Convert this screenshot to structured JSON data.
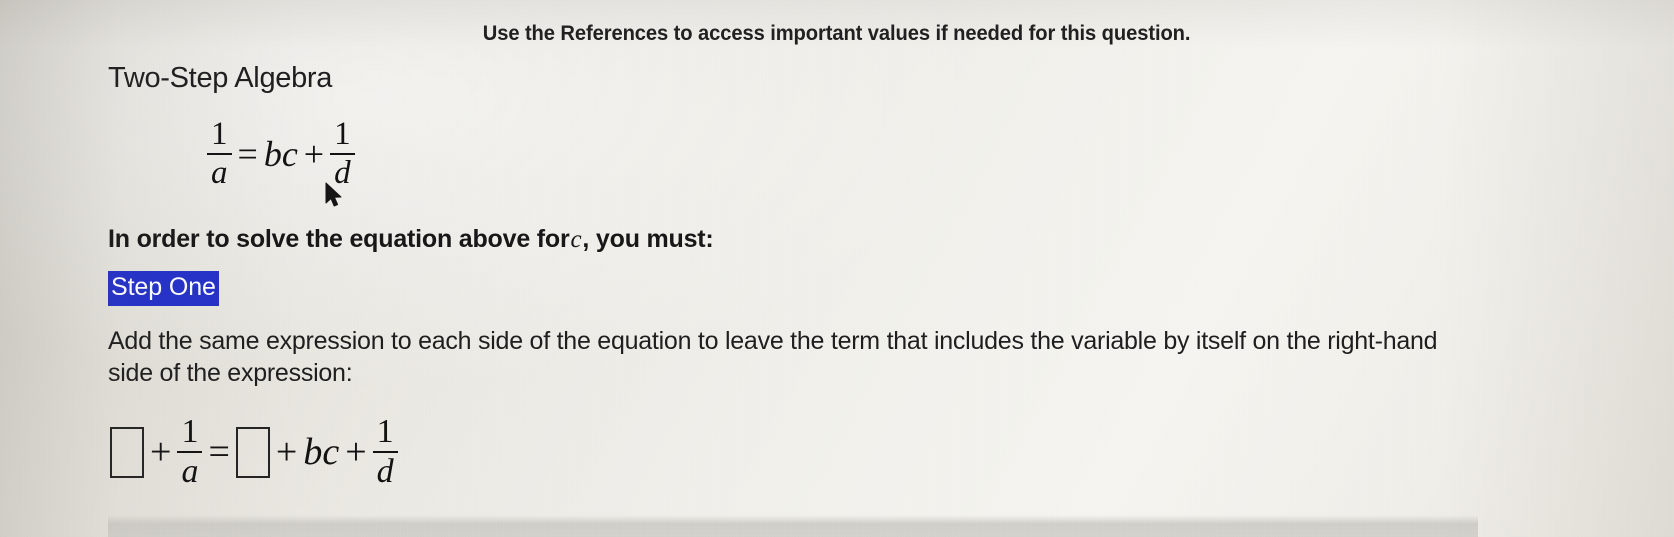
{
  "banner": {
    "text": "Use the References to access important values if needed for this question."
  },
  "page": {
    "title": "Two-Step Algebra"
  },
  "equation_main": {
    "lhs_num": "1",
    "lhs_den": "a",
    "equals": "=",
    "term_bc": "bc",
    "plus": "+",
    "rhs_num": "1",
    "rhs_den": "d",
    "plain": "1/a = bc + 1/d"
  },
  "prompt": {
    "before": "In order to solve the equation above for",
    "variable": "c",
    "after": ", you must:"
  },
  "step_label": {
    "text": "Step One",
    "highlight_color": "#2330c9",
    "text_color": "#ffffff"
  },
  "instruction": {
    "text": "Add the same expression to each side of the equation to leave the term that includes the variable by itself on the right-hand side of the expression:"
  },
  "equation_answer": {
    "box_left_placeholder": "",
    "plus1": "+",
    "lhs_num": "1",
    "lhs_den": "a",
    "equals": "=",
    "box_right_placeholder": "",
    "plus2": "+",
    "term_bc": "bc",
    "plus3": "+",
    "rhs_num": "1",
    "rhs_den": "d",
    "plain": "[ ] + 1/a = [ ] + bc + 1/d"
  },
  "cursor": {
    "icon": "mouse-pointer"
  }
}
